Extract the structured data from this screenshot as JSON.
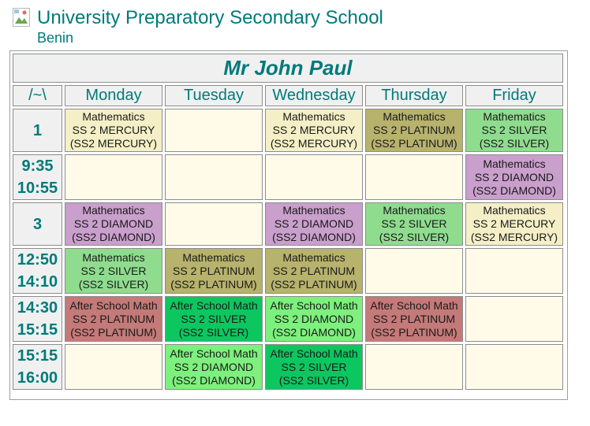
{
  "school": {
    "name": "University Preparatory Secondary School",
    "location": "Benin"
  },
  "timetable": {
    "teacher": "Mr John Paul",
    "corner": "/~\\",
    "days": [
      "Monday",
      "Tuesday",
      "Wednesday",
      "Thursday",
      "Friday"
    ],
    "periods": [
      {
        "label1": "1",
        "label2": "",
        "cells": [
          {
            "subject": "Mathematics",
            "class": "SS 2 MERCURY",
            "code": "(SS2 MERCURY)",
            "color": "#f4efc6"
          },
          null,
          {
            "subject": "Mathematics",
            "class": "SS 2 MERCURY",
            "code": "(SS2 MERCURY)",
            "color": "#f4efc6"
          },
          {
            "subject": "Mathematics",
            "class": "SS 2 PLATINUM",
            "code": "(SS2 PLATINUM)",
            "color": "#b7b26c"
          },
          {
            "subject": "Mathematics",
            "class": "SS 2 SILVER",
            "code": "(SS2 SILVER)",
            "color": "#8fdc8f"
          }
        ]
      },
      {
        "label1": "9:35",
        "label2": "10:55",
        "cells": [
          null,
          null,
          null,
          null,
          {
            "subject": "Mathematics",
            "class": "SS 2 DIAMOND",
            "code": "(SS2 DIAMOND)",
            "color": "#c99fcc"
          }
        ]
      },
      {
        "label1": "3",
        "label2": "",
        "cells": [
          {
            "subject": "Mathematics",
            "class": "SS 2 DIAMOND",
            "code": "(SS2 DIAMOND)",
            "color": "#c99fcc"
          },
          null,
          {
            "subject": "Mathematics",
            "class": "SS 2 DIAMOND",
            "code": "(SS2 DIAMOND)",
            "color": "#c99fcc"
          },
          {
            "subject": "Mathematics",
            "class": "SS 2 SILVER",
            "code": "(SS2 SILVER)",
            "color": "#8fdc8f"
          },
          {
            "subject": "Mathematics",
            "class": "SS 2 MERCURY",
            "code": "(SS2 MERCURY)",
            "color": "#f4efc6"
          }
        ]
      },
      {
        "label1": "12:50",
        "label2": "14:10",
        "cells": [
          {
            "subject": "Mathematics",
            "class": "SS 2 SILVER",
            "code": "(SS2 SILVER)",
            "color": "#8fdc8f"
          },
          {
            "subject": "Mathematics",
            "class": "SS 2 PLATINUM",
            "code": "(SS2 PLATINUM)",
            "color": "#b7b26c"
          },
          {
            "subject": "Mathematics",
            "class": "SS 2 PLATINUM",
            "code": "(SS2 PLATINUM)",
            "color": "#b7b26c"
          },
          null,
          null
        ]
      },
      {
        "label1": "14:30",
        "label2": "15:15",
        "cells": [
          {
            "subject": "After School Math",
            "class": "SS 2 PLATINUM",
            "code": "(SS2 PLATINUM)",
            "color": "#c47a78"
          },
          {
            "subject": "After School Math",
            "class": "SS 2 SILVER",
            "code": "(SS2 SILVER)",
            "color": "#0cc760"
          },
          {
            "subject": "After School Math",
            "class": "SS 2 DIAMOND",
            "code": "(SS2 DIAMOND)",
            "color": "#7df07d"
          },
          {
            "subject": "After School Math",
            "class": "SS 2 PLATINUM",
            "code": "(SS2 PLATINUM)",
            "color": "#c47a78"
          },
          null
        ]
      },
      {
        "label1": "15:15",
        "label2": "16:00",
        "cells": [
          null,
          {
            "subject": "After School Math",
            "class": "SS 2 DIAMOND",
            "code": "(SS2 DIAMOND)",
            "color": "#7df07d"
          },
          {
            "subject": "After School Math",
            "class": "SS 2 SILVER",
            "code": "(SS2 SILVER)",
            "color": "#0cc760"
          },
          null,
          null
        ]
      }
    ]
  }
}
